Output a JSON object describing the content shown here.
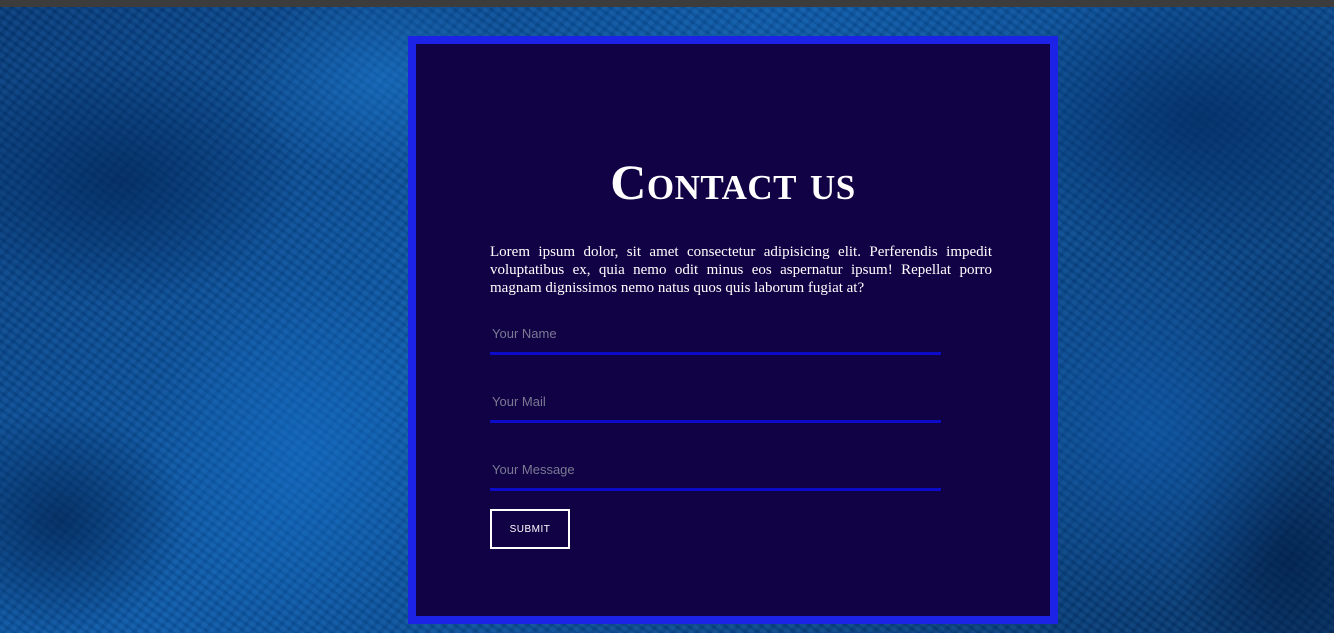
{
  "contact": {
    "title": "Contact us",
    "description": "Lorem ipsum dolor, sit amet consectetur adipisicing elit. Perferendis impedit voluptatibus ex, quia nemo odit minus eos aspernatur ipsum! Repellat porro magnam dignissimos nemo natus quos quis laborum fugiat at?",
    "form": {
      "name_placeholder": "Your Name",
      "name_value": "",
      "mail_placeholder": "Your Mail",
      "mail_value": "",
      "message_placeholder": "Your Message",
      "message_value": "",
      "submit_label": "SUBMIT"
    }
  },
  "colors": {
    "card_background": "#110245",
    "card_border": "#1c22e6",
    "field_underline": "#0b0bc8",
    "text": "#ffffff",
    "page_background": "#0a4a8a"
  }
}
